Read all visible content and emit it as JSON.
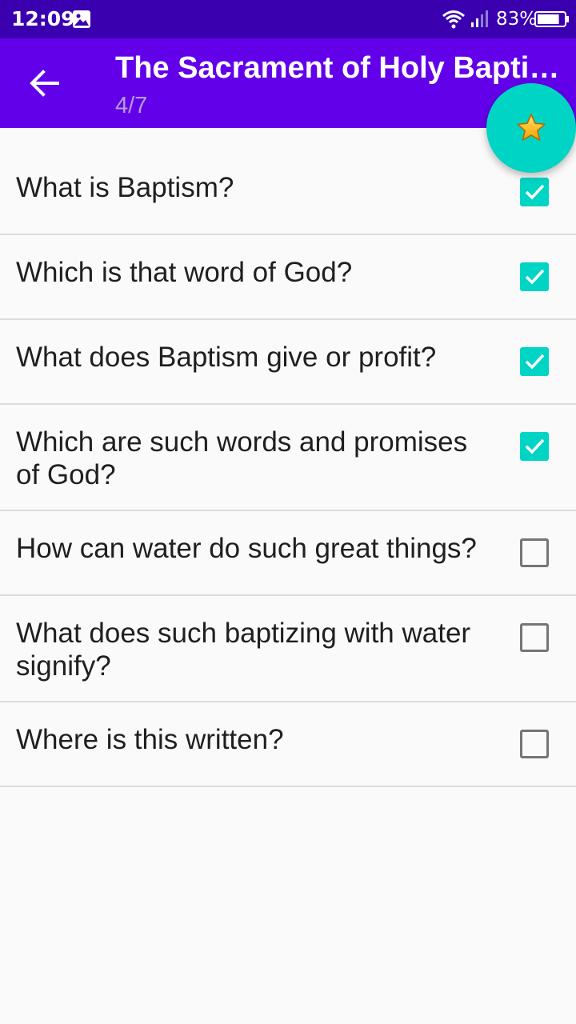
{
  "status_bar": {
    "time": "12:09",
    "battery_percent": "83%",
    "battery_level": 0.83,
    "icons": [
      "image-icon",
      "wifi-icon",
      "signal-icon",
      "battery-icon"
    ]
  },
  "app_bar": {
    "title": "The Sacrament of Holy Baptism",
    "subtitle": "4/7",
    "back_icon": "arrow-back-icon",
    "background_color": "#6200ea"
  },
  "fab": {
    "icon": "star-icon",
    "color": "#00d4c4"
  },
  "questions": [
    {
      "text": "What is Baptism?",
      "checked": true
    },
    {
      "text": "Which is that word of God?",
      "checked": true
    },
    {
      "text": "What does Baptism give or profit?",
      "checked": true
    },
    {
      "text": "Which are such words and promises of God?",
      "checked": true
    },
    {
      "text": "How can water do such great things?",
      "checked": false
    },
    {
      "text": "What does such baptizing with water signify?",
      "checked": false
    },
    {
      "text": "Where is this written?",
      "checked": false
    }
  ],
  "colors": {
    "accent": "#00d4c4",
    "status_bar": "#3a00b0",
    "divider": "#dcdcdc",
    "background": "#fafafa"
  }
}
